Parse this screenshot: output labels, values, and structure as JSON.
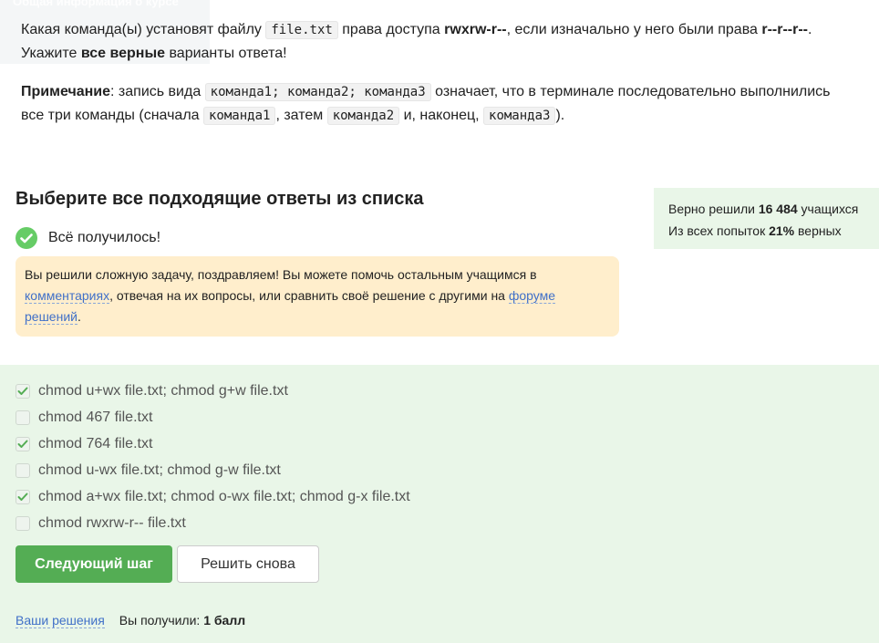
{
  "hint_overlay": {
    "label": "Общая информация о курсе"
  },
  "question": {
    "p1": {
      "part1": "Какая команда(ы) установят файлу ",
      "code": "file.txt",
      "part2": " права доступа ",
      "target": "rwxrw-r--",
      "part3": ", если изначально у него были права ",
      "initial": "r--r--r--",
      "part4": ". Укажите ",
      "bold": "все верные",
      "part5": " варианты ответа!"
    },
    "note": {
      "label": "Примечание",
      "part1": ": запись вида ",
      "code1": "команда1; команда2; команда3",
      "part2": " означает, что в терминале последовательно выполнились все три команды (сначала ",
      "code2": "команда1",
      "part3": ", затем ",
      "code3": "команда2",
      "part4": " и, наконец, ",
      "code4": "команда3",
      "part5": ")."
    }
  },
  "section_title": "Выберите все подходящие ответы из списка",
  "success_text": "Всё получилось!",
  "notice": {
    "part1": "Вы решили сложную задачу, поздравляем! Вы можете помочь остальным учащимся в ",
    "link1": "комментариях",
    "part2": ", отвечая на их вопросы, или сравнить своё решение с другими на ",
    "link2": "форуме решений",
    "part3": "."
  },
  "stats": {
    "line1_pre": "Верно решили ",
    "line1_num": "16 484",
    "line1_post": " учащихся",
    "line2_pre": "Из всех попыток ",
    "line2_num": "21%",
    "line2_post": " верных"
  },
  "options": [
    {
      "label": "chmod u+wx file.txt; chmod g+w file.txt",
      "checked": true
    },
    {
      "label": "chmod 467 file.txt",
      "checked": false
    },
    {
      "label": "chmod 764 file.txt",
      "checked": true
    },
    {
      "label": "chmod u-wx file.txt; chmod g-w file.txt",
      "checked": false
    },
    {
      "label": "chmod a+wx file.txt; chmod o-wx file.txt; chmod g-x file.txt",
      "checked": true
    },
    {
      "label": "chmod rwxrw-r-- file.txt",
      "checked": false
    }
  ],
  "buttons": {
    "next": "Следующий шаг",
    "retry": "Решить снова"
  },
  "footer": {
    "solutions_link": "Ваши решения",
    "score_pre": "Вы получили: ",
    "score_value": "1 балл"
  },
  "colors": {
    "accent_green": "#54ad54",
    "check_green": "#66cc66",
    "notice_bg": "#ffeecc",
    "answers_bg": "#e9f6e8"
  }
}
